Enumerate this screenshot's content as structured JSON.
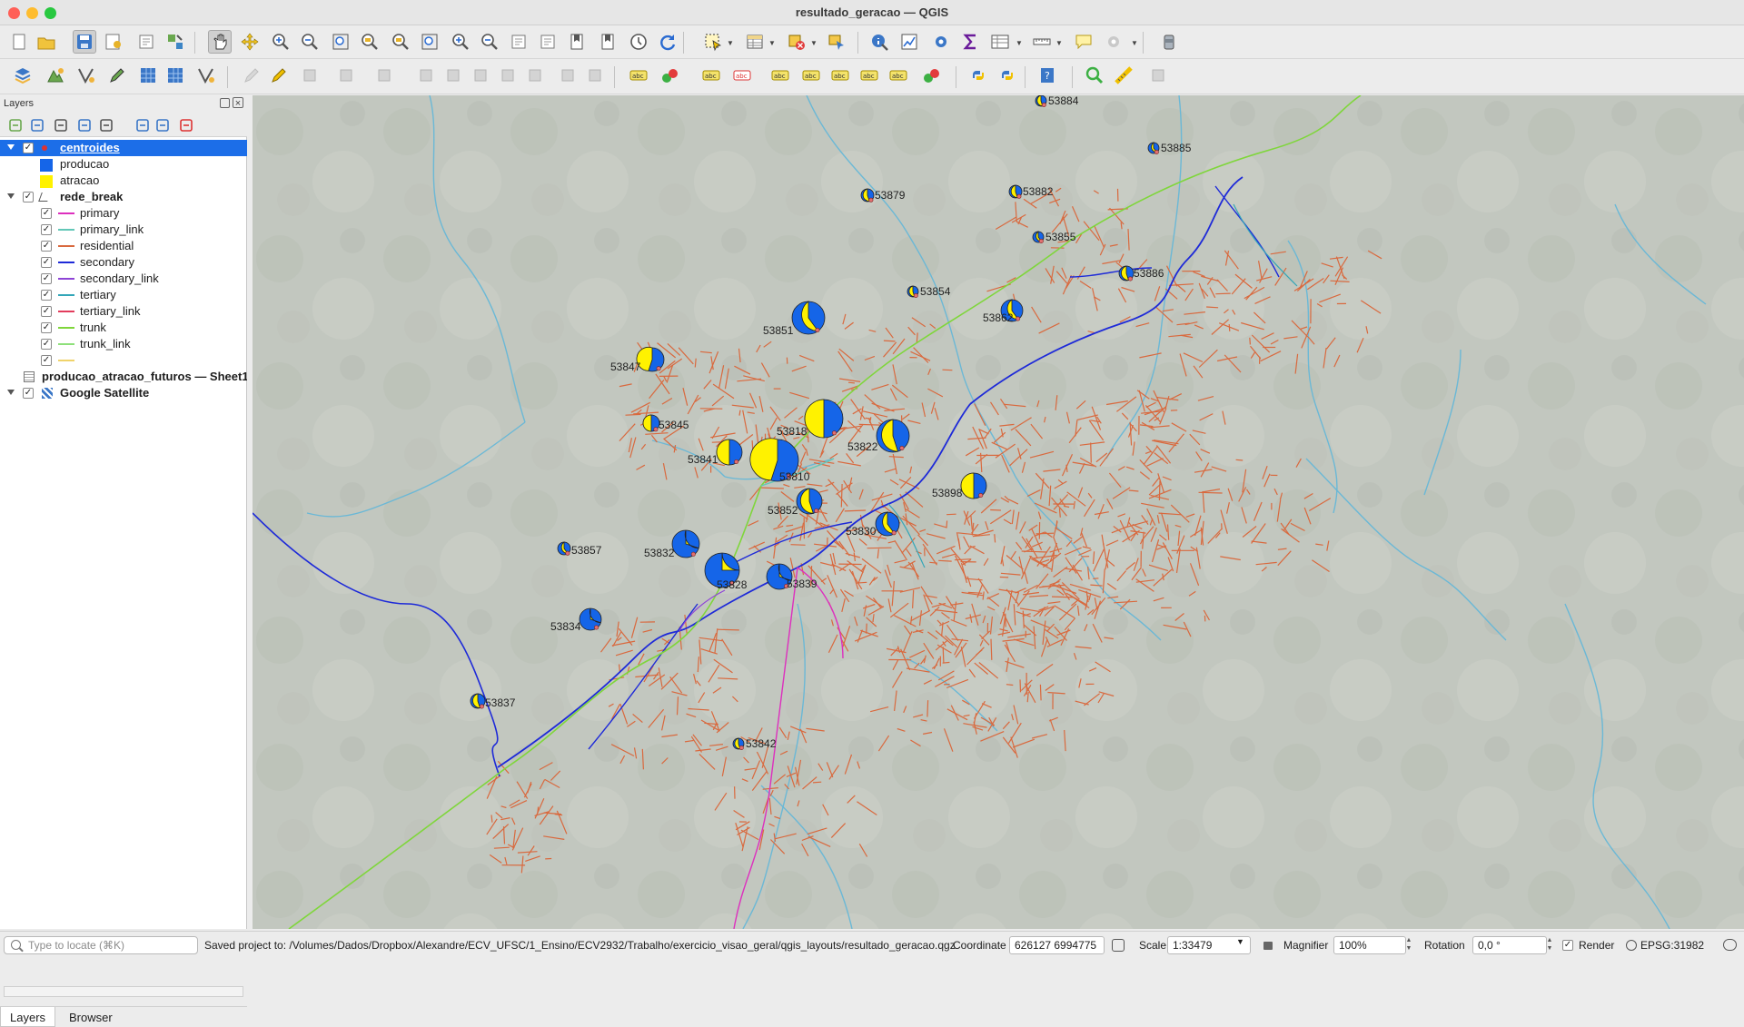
{
  "window": {
    "title": "resultado_geracao — QGIS"
  },
  "panel": {
    "title": "Layers",
    "tabs": [
      "Layers",
      "Browser"
    ],
    "layers": [
      {
        "name": "centroides",
        "checked": true,
        "selected": true,
        "legend": [
          {
            "label": "producao",
            "color": "#1565e8"
          },
          {
            "label": "atracao",
            "color": "#fff200"
          }
        ]
      },
      {
        "name": "rede_break",
        "checked": true,
        "legend": [
          {
            "label": "primary",
            "color": "#dd2fbe"
          },
          {
            "label": "primary_link",
            "color": "#62c7b7"
          },
          {
            "label": "residential",
            "color": "#d9693e"
          },
          {
            "label": "secondary",
            "color": "#1e2ad8"
          },
          {
            "label": "secondary_link",
            "color": "#8e44d6"
          },
          {
            "label": "tertiary",
            "color": "#33a6b8"
          },
          {
            "label": "tertiary_link",
            "color": "#e23c5c"
          },
          {
            "label": "trunk",
            "color": "#7fd63b"
          },
          {
            "label": "trunk_link",
            "color": "#8ee07a"
          },
          {
            "label": "",
            "color": "#f0d36a"
          }
        ]
      },
      {
        "name": "producao_atracao_futuros — Sheet1"
      },
      {
        "name": "Google Satellite",
        "checked": true
      }
    ]
  },
  "map": {
    "colors": {
      "producao": "#1565e8",
      "atracao": "#fff200"
    },
    "centroids": [
      {
        "id": "53884",
        "atracao_share": 0.45
      },
      {
        "id": "53885",
        "atracao_share": 0.4
      },
      {
        "id": "53879",
        "atracao_share": 0.45
      },
      {
        "id": "53882",
        "atracao_share": 0.45
      },
      {
        "id": "53855",
        "atracao_share": 0.4
      },
      {
        "id": "53886",
        "atracao_share": 0.45
      },
      {
        "id": "53854",
        "atracao_share": 0.45
      },
      {
        "id": "53862",
        "atracao_share": 0.4
      },
      {
        "id": "53851",
        "atracao_share": 0.4
      },
      {
        "id": "53847",
        "atracao_share": 0.55
      },
      {
        "id": "53845",
        "atracao_share": 0.5
      },
      {
        "id": "53818",
        "atracao_share": 0.5
      },
      {
        "id": "53822",
        "atracao_share": 0.45
      },
      {
        "id": "53841",
        "atracao_share": 0.5
      },
      {
        "id": "53810",
        "atracao_share": 0.55
      },
      {
        "id": "53898",
        "atracao_share": 0.5
      },
      {
        "id": "53852",
        "atracao_share": 0.45
      },
      {
        "id": "53830",
        "atracao_share": 0.4
      },
      {
        "id": "53857",
        "atracao_share": 0.4
      },
      {
        "id": "53832",
        "atracao_share": 0.3
      },
      {
        "id": "53828",
        "atracao_share": 0.25
      },
      {
        "id": "53839",
        "atracao_share": 0.3
      },
      {
        "id": "53834",
        "atracao_share": 0.3
      },
      {
        "id": "53837",
        "atracao_share": 0.45
      },
      {
        "id": "53842",
        "atracao_share": 0.45
      }
    ]
  },
  "status": {
    "locator_placeholder": "Type to locate (⌘K)",
    "message": "Saved project to: /Volumes/Dados/Dropbox/Alexandre/ECV_UFSC/1_Ensino/ECV2932/Trabalho/exercicio_visao_geral/qgis_layouts/resultado_geracao.qgz",
    "coordinate_label": "Coordinate",
    "coordinate": "626127 6994775",
    "scale_label": "Scale",
    "scale": "1:33479",
    "magnifier_label": "Magnifier",
    "magnifier": "100%",
    "rotation_label": "Rotation",
    "rotation": "0,0 °",
    "render_label": "Render",
    "crs": "EPSG:31982"
  }
}
